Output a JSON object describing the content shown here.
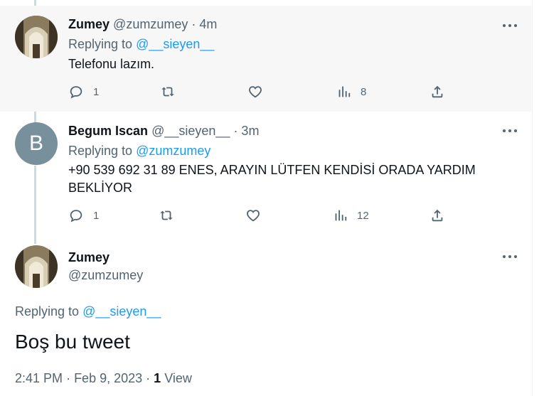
{
  "tweets": [
    {
      "name": "Zumey",
      "handle": "@zumzumey",
      "time": "· 4m",
      "replying_prefix": "Replying to",
      "replying_handle": "@__sieyen__",
      "text": "Telefonu lazım.",
      "replies": "1",
      "retweets": "",
      "likes": "",
      "views": "8"
    },
    {
      "avatar_letter": "B",
      "name": "Begum Iscan",
      "handle": "@__sieyen__",
      "time": "· 3m",
      "replying_prefix": "Replying to",
      "replying_handle": "@zumzumey",
      "text": "+90 539 692 31 89 ENES, ARAYIN LÜTFEN KENDİSİ ORADA YARDIM BEKLİYOR",
      "replies": "1",
      "retweets": "",
      "likes": "",
      "views": "12"
    }
  ],
  "main_tweet": {
    "name": "Zumey",
    "handle": "@zumzumey",
    "replying_prefix": "Replying to",
    "replying_handle": "@__sieyen__",
    "text": "Boş bu tweet",
    "time": "2:41 PM",
    "date": "Feb 9, 2023",
    "views_count": "1",
    "views_label": "View"
  },
  "colors": {
    "link": "#1d9bf0",
    "secondary": "#536471",
    "thread_line": "#cfd9de",
    "avatar_letter_bg": "#78909c"
  },
  "icons": [
    "more-icon",
    "reply-icon",
    "retweet-icon",
    "like-icon",
    "views-icon",
    "share-icon"
  ]
}
